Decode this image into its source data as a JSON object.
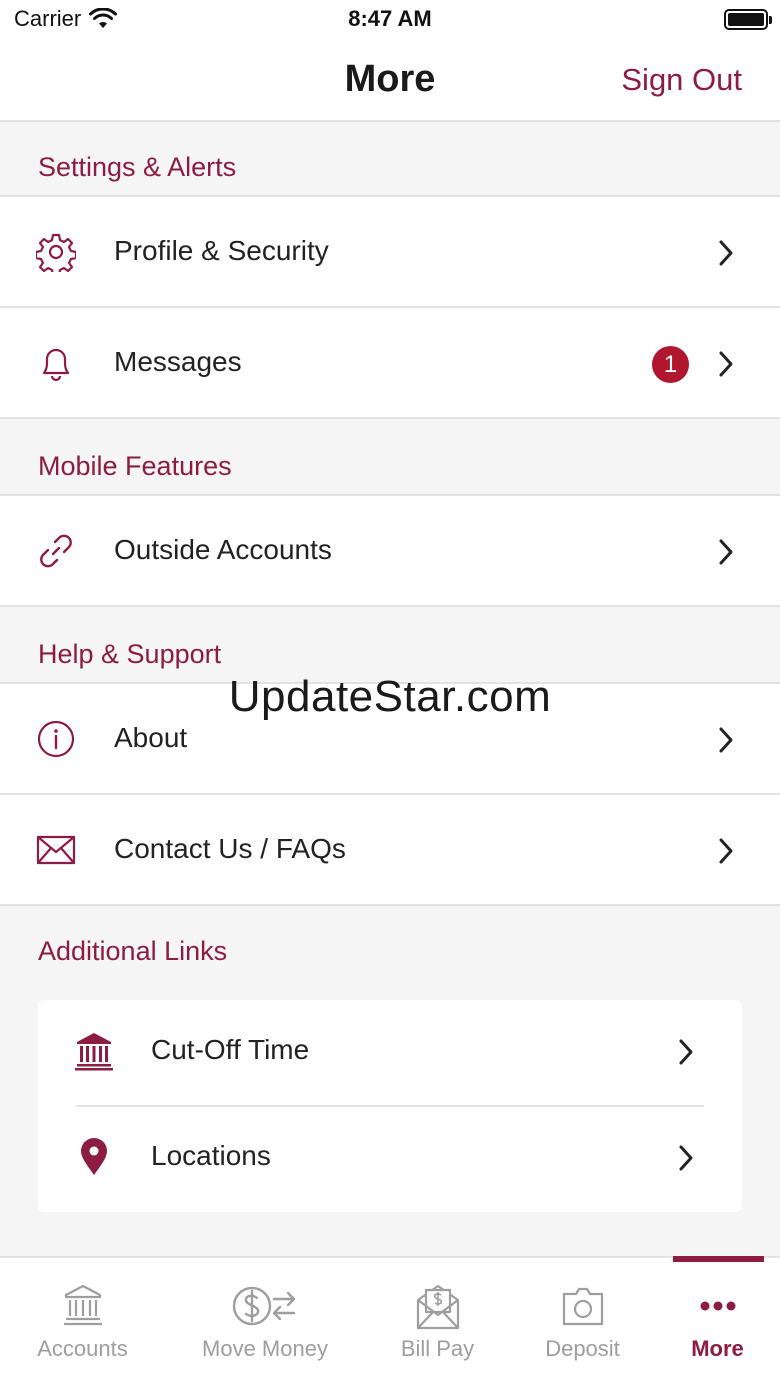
{
  "status_bar": {
    "carrier": "Carrier",
    "time": "8:47 AM"
  },
  "header": {
    "title": "More",
    "sign_out": "Sign Out"
  },
  "colors": {
    "accent": "#8c1d40",
    "badge": "#b0162e",
    "inactive": "#9e9e9e"
  },
  "sections": [
    {
      "title": "Settings & Alerts",
      "items": [
        {
          "label": "Profile & Security",
          "icon": "gear-icon"
        },
        {
          "label": "Messages",
          "icon": "bell-icon",
          "badge": "1"
        }
      ]
    },
    {
      "title": "Mobile Features",
      "items": [
        {
          "label": "Outside Accounts",
          "icon": "link-icon"
        }
      ]
    },
    {
      "title": "Help & Support",
      "items": [
        {
          "label": "About",
          "icon": "info-icon"
        },
        {
          "label": "Contact Us / FAQs",
          "icon": "envelope-icon"
        }
      ]
    },
    {
      "title": "Additional Links",
      "items": [
        {
          "label": "Cut-Off Time",
          "icon": "bank-icon"
        },
        {
          "label": "Locations",
          "icon": "map-pin-icon"
        }
      ]
    }
  ],
  "watermark": "UpdateStar.com",
  "tab_bar": {
    "tabs": [
      {
        "label": "Accounts",
        "icon": "bank-icon"
      },
      {
        "label": "Move Money",
        "icon": "transfer-icon"
      },
      {
        "label": "Bill Pay",
        "icon": "bill-envelope-icon"
      },
      {
        "label": "Deposit",
        "icon": "camera-icon"
      },
      {
        "label": "More",
        "icon": "more-dots-icon",
        "active": true
      }
    ]
  }
}
